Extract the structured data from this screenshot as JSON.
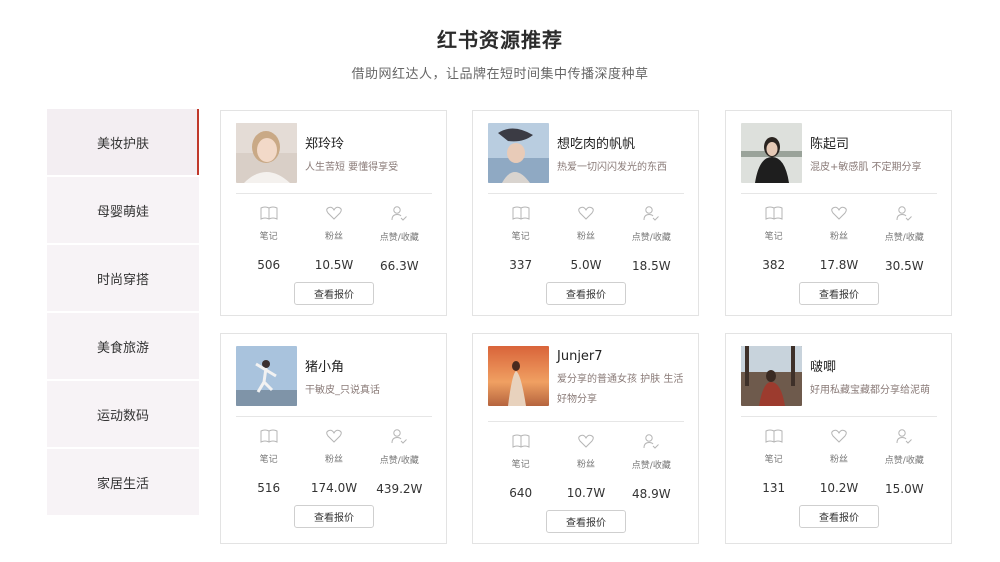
{
  "header": {
    "title": "红书资源推荐",
    "subtitle": "借助网红达人，让品牌在短时间集中传播深度种草"
  },
  "sidebar": {
    "items": [
      {
        "label": "美妆护肤",
        "active": true
      },
      {
        "label": "母婴萌娃"
      },
      {
        "label": "时尚穿搭"
      },
      {
        "label": "美食旅游"
      },
      {
        "label": "运动数码"
      },
      {
        "label": "家居生活"
      }
    ]
  },
  "stat_labels": {
    "notes": "笔记",
    "fans": "粉丝",
    "likes": "点赞/收藏"
  },
  "button_label": "查看报价",
  "cards": [
    {
      "name": "郑玲玲",
      "bio": "人生苦短 要懂得享受",
      "notes": "506",
      "fans": "10.5W",
      "likes": "66.3W"
    },
    {
      "name": "想吃肉的帆帆",
      "bio": "热爱一切闪闪发光的东西",
      "notes": "337",
      "fans": "5.0W",
      "likes": "18.5W"
    },
    {
      "name": "陈起司",
      "bio": "混皮+敏感肌 不定期分享",
      "notes": "382",
      "fans": "17.8W",
      "likes": "30.5W"
    },
    {
      "name": "猪小角",
      "bio": "干敏皮_只说真话",
      "notes": "516",
      "fans": "174.0W",
      "likes": "439.2W"
    },
    {
      "name": "Junjer7",
      "bio": "爱分享的普通女孩 护肤 生活好物分享",
      "notes": "640",
      "fans": "10.7W",
      "likes": "48.9W"
    },
    {
      "name": "啵唧",
      "bio": "好用私藏宝藏都分享给泥萌",
      "notes": "131",
      "fans": "10.2W",
      "likes": "15.0W"
    }
  ]
}
